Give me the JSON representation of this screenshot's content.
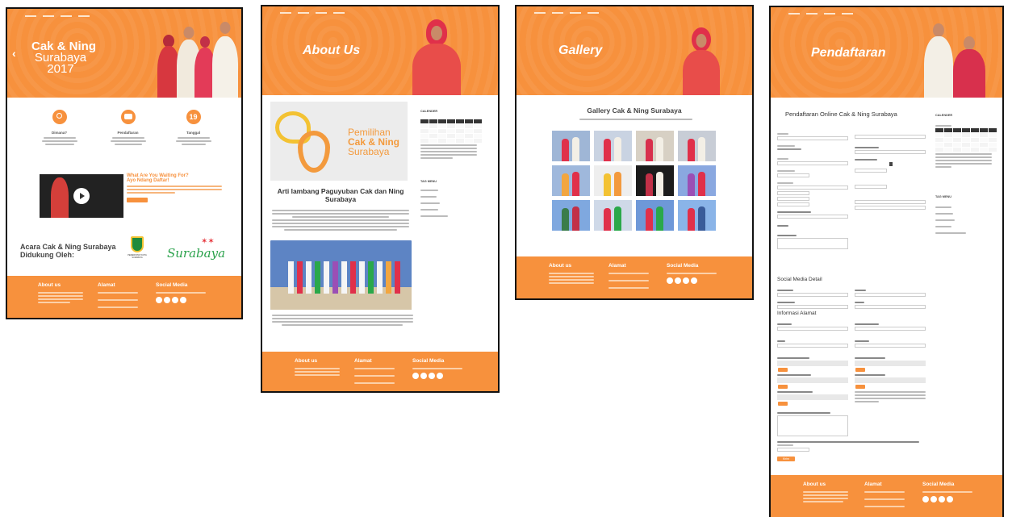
{
  "home": {
    "hero_title_1": "Cak & Ning",
    "hero_title_2": "Surabaya",
    "hero_title_3": "2017",
    "features": [
      {
        "title": "Dimana?",
        "icon": "search-icon"
      },
      {
        "title": "Pendaftaran",
        "icon": "chat-icon"
      },
      {
        "title": "Tanggal",
        "icon_text": "19"
      }
    ],
    "cta_title_1": "What Are You Waiting For?",
    "cta_title_2": "Ayo Ndang Daftar!",
    "support_1": "Acara Cak & Ning Surabaya",
    "support_2": "Didukung Oleh:",
    "sponsor_seal_text": "PEMERINTAH KOTA SURABAYA",
    "sponsor_logo_text": "Surabaya"
  },
  "about": {
    "hero_title": "About Us",
    "logo_line_1": "Pemilihan",
    "logo_line_2": "Cak & Ning",
    "logo_line_3": "Surabaya",
    "article_title": "Arti lambang Paguyuban Cak dan Ning Surabaya",
    "calendar_heading": "CALENDER",
    "tag_heading": "TAG MENU"
  },
  "gallery": {
    "hero_title": "Gallery",
    "heading": "Gallery Cak & Ning Surabaya"
  },
  "register": {
    "hero_title": "Pendaftaran",
    "form_title": "Pendaftaran Online Cak & Ning Surabaya",
    "section_social": "Social Media Detail",
    "section_info": "Informasi Alamat",
    "submit_label": "Kirim",
    "sidebar_calendar": "CALENDER",
    "sidebar_tags": "TAG MENU"
  },
  "footer": {
    "about": "About us",
    "address": "Alamat",
    "social": "Social Media"
  },
  "colors": {
    "accent": "#f7913d"
  }
}
